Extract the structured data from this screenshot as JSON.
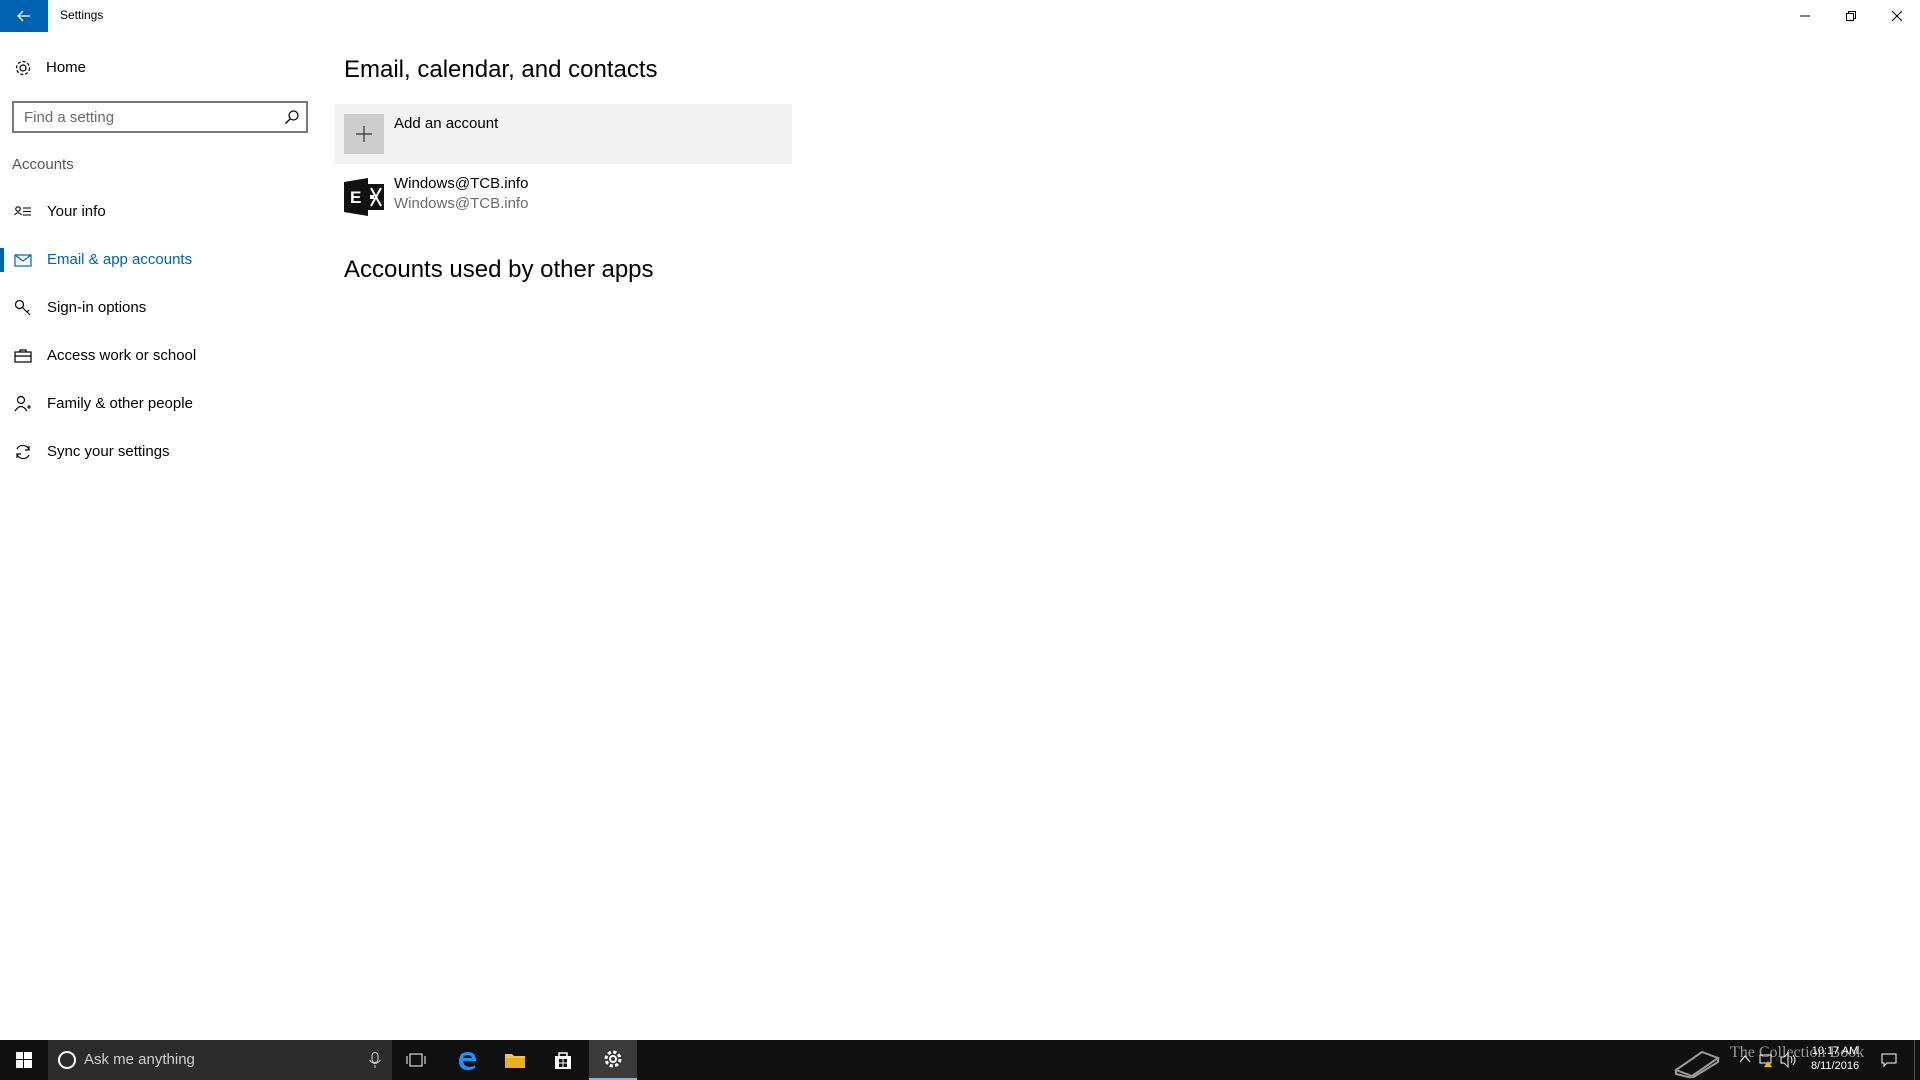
{
  "window": {
    "title": "Settings"
  },
  "sidebar": {
    "home_label": "Home",
    "search_placeholder": "Find a setting",
    "section_label": "Accounts",
    "items": [
      {
        "label": "Your info"
      },
      {
        "label": "Email & app accounts"
      },
      {
        "label": "Sign-in options"
      },
      {
        "label": "Access work or school"
      },
      {
        "label": "Family & other people"
      },
      {
        "label": "Sync your settings"
      }
    ],
    "active_index": 1
  },
  "main": {
    "heading1": "Email, calendar, and contacts",
    "add_account_label": "Add an account",
    "account": {
      "name": "Windows@TCB.info",
      "detail": "Windows@TCB.info"
    },
    "heading2": "Accounts used by other apps"
  },
  "taskbar": {
    "search_placeholder": "Ask me anything",
    "time": "10:17 AM",
    "date": "8/11/2016",
    "watermark": "The Collection Book"
  },
  "colors": {
    "accent": "#0063b1",
    "taskbar": "#101010"
  }
}
